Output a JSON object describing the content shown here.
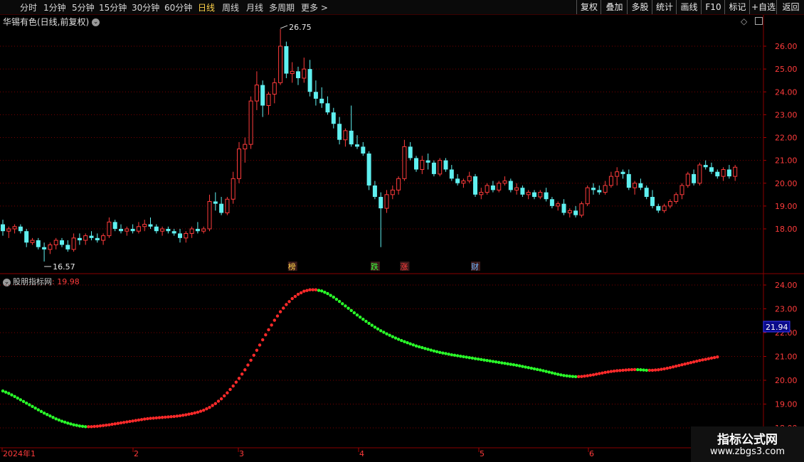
{
  "toolbar": {
    "periods": [
      "分时",
      "1分钟",
      "5分钟",
      "15分钟",
      "30分钟",
      "60分钟",
      "日线",
      "周线",
      "月线",
      "多周期",
      "更多 >"
    ],
    "active_period": "日线",
    "right_buttons": [
      "复权",
      "叠加",
      "多股",
      "统计",
      "画线",
      "F10",
      "标记",
      "+自选",
      "返回"
    ]
  },
  "main_panel": {
    "title": "华锡有色(日线,前复权)",
    "price_labels": [
      "26.00",
      "25.00",
      "24.00",
      "23.00",
      "22.00",
      "21.00",
      "20.00",
      "19.00",
      "18.00"
    ],
    "high_marker": "26.75",
    "low_marker": "16.57",
    "event_tags": [
      {
        "text": "榜",
        "color": "#ffd24a"
      },
      {
        "text": "跌",
        "color": "#3cff3c"
      },
      {
        "text": "涨",
        "color": "#ff3b3b"
      },
      {
        "text": "财",
        "color": "#6fb4ff"
      }
    ]
  },
  "sub_panel": {
    "name": "股朋指标网",
    "value": ": 19.98",
    "axis_labels": [
      "24.00",
      "23.00",
      "22.00",
      "21.00",
      "20.00",
      "19.00",
      "18.00"
    ],
    "current_value_badge": "21.94"
  },
  "x_axis": {
    "labels": [
      "2024年1",
      "2",
      "3",
      "4",
      "5",
      "6"
    ]
  },
  "watermark": {
    "title": "指标公式网",
    "url": "www.zbgs3.com"
  },
  "colors": {
    "up": "#ff3b3b",
    "down": "#5ff0f0",
    "indicator_up": "#ff2a2a",
    "indicator_down": "#2aff2a",
    "grid": "#7a0000",
    "active": "#ffd24a"
  },
  "chart_data": {
    "type": "candlestick",
    "title": "华锡有色(日线,前复权)",
    "ylim": [
      17.0,
      26.8
    ],
    "high": 26.75,
    "low": 16.57,
    "ohlc": [
      [
        18.2,
        18.4,
        17.7,
        17.9
      ],
      [
        17.9,
        18.1,
        17.6,
        18.0
      ],
      [
        18.0,
        18.2,
        17.8,
        18.1
      ],
      [
        18.1,
        18.2,
        17.8,
        17.9
      ],
      [
        17.9,
        18.0,
        17.2,
        17.4
      ],
      [
        17.4,
        17.6,
        17.3,
        17.5
      ],
      [
        17.5,
        17.6,
        17.1,
        17.2
      ],
      [
        17.2,
        17.4,
        16.57,
        17.1
      ],
      [
        17.1,
        17.4,
        16.9,
        17.3
      ],
      [
        17.3,
        17.6,
        17.1,
        17.5
      ],
      [
        17.5,
        17.6,
        17.2,
        17.3
      ],
      [
        17.3,
        17.5,
        17.0,
        17.1
      ],
      [
        17.1,
        17.8,
        17.0,
        17.6
      ],
      [
        17.6,
        17.8,
        17.3,
        17.5
      ],
      [
        17.5,
        17.8,
        17.3,
        17.7
      ],
      [
        17.7,
        17.9,
        17.5,
        17.6
      ],
      [
        17.6,
        17.8,
        17.4,
        17.5
      ],
      [
        17.5,
        17.8,
        17.3,
        17.7
      ],
      [
        17.7,
        18.5,
        17.6,
        18.3
      ],
      [
        18.3,
        18.4,
        17.9,
        18.0
      ],
      [
        18.0,
        18.2,
        17.8,
        17.9
      ],
      [
        17.9,
        18.1,
        17.7,
        18.0
      ],
      [
        18.0,
        18.2,
        17.8,
        17.9
      ],
      [
        17.9,
        18.3,
        17.8,
        18.1
      ],
      [
        18.1,
        18.4,
        17.9,
        18.2
      ],
      [
        18.2,
        18.5,
        18.0,
        18.1
      ],
      [
        18.1,
        18.2,
        17.8,
        17.9
      ],
      [
        17.9,
        18.1,
        17.7,
        18.0
      ],
      [
        18.0,
        18.1,
        17.8,
        17.9
      ],
      [
        17.9,
        18.0,
        17.7,
        17.8
      ],
      [
        17.8,
        18.0,
        17.4,
        17.6
      ],
      [
        17.6,
        17.9,
        17.4,
        17.8
      ],
      [
        17.8,
        18.1,
        17.6,
        18.0
      ],
      [
        18.0,
        18.3,
        17.8,
        17.9
      ],
      [
        17.9,
        18.1,
        17.8,
        18.0
      ],
      [
        18.0,
        19.5,
        17.9,
        19.2
      ],
      [
        19.2,
        19.6,
        18.8,
        19.1
      ],
      [
        19.1,
        19.4,
        18.6,
        18.7
      ],
      [
        18.7,
        19.4,
        18.6,
        19.3
      ],
      [
        19.3,
        20.5,
        19.1,
        20.2
      ],
      [
        20.2,
        21.8,
        20.0,
        21.5
      ],
      [
        21.5,
        22.0,
        20.9,
        21.7
      ],
      [
        21.7,
        23.8,
        21.5,
        23.6
      ],
      [
        23.6,
        24.9,
        23.2,
        24.3
      ],
      [
        24.3,
        24.5,
        22.9,
        23.4
      ],
      [
        23.4,
        24.0,
        23.0,
        23.9
      ],
      [
        23.9,
        24.6,
        23.5,
        24.4
      ],
      [
        24.4,
        26.75,
        24.3,
        26.0
      ],
      [
        26.0,
        26.2,
        24.6,
        24.8
      ],
      [
        24.8,
        25.3,
        24.4,
        24.9
      ],
      [
        24.9,
        25.1,
        24.3,
        24.6
      ],
      [
        24.6,
        25.5,
        24.4,
        25.0
      ],
      [
        25.0,
        25.4,
        23.8,
        24.0
      ],
      [
        24.0,
        24.5,
        23.4,
        23.7
      ],
      [
        23.7,
        24.2,
        23.3,
        23.5
      ],
      [
        23.5,
        23.8,
        23.0,
        23.1
      ],
      [
        23.1,
        23.3,
        22.4,
        22.6
      ],
      [
        22.6,
        22.9,
        21.7,
        21.9
      ],
      [
        21.9,
        22.4,
        21.6,
        22.3
      ],
      [
        22.3,
        23.4,
        21.6,
        21.7
      ],
      [
        21.7,
        22.1,
        21.5,
        21.6
      ],
      [
        21.6,
        21.8,
        21.2,
        21.3
      ],
      [
        21.3,
        21.4,
        19.7,
        19.9
      ],
      [
        19.9,
        20.1,
        19.3,
        19.4
      ],
      [
        19.4,
        19.6,
        17.2,
        18.9
      ],
      [
        18.9,
        19.7,
        18.7,
        19.5
      ],
      [
        19.5,
        19.9,
        19.3,
        19.7
      ],
      [
        19.7,
        20.3,
        19.5,
        20.2
      ],
      [
        20.2,
        21.9,
        20.1,
        21.6
      ],
      [
        21.6,
        21.8,
        21.0,
        21.1
      ],
      [
        21.1,
        21.2,
        20.5,
        20.6
      ],
      [
        20.6,
        21.2,
        20.4,
        21.0
      ],
      [
        21.0,
        21.3,
        20.6,
        20.9
      ],
      [
        20.9,
        21.0,
        20.3,
        20.4
      ],
      [
        20.4,
        21.1,
        20.3,
        21.0
      ],
      [
        21.0,
        21.1,
        20.5,
        20.6
      ],
      [
        20.6,
        20.8,
        20.1,
        20.2
      ],
      [
        20.2,
        20.4,
        19.9,
        20.0
      ],
      [
        20.0,
        20.2,
        19.8,
        20.1
      ],
      [
        20.1,
        20.5,
        20.0,
        20.3
      ],
      [
        20.3,
        20.4,
        19.4,
        19.5
      ],
      [
        19.5,
        19.8,
        19.3,
        19.6
      ],
      [
        19.6,
        20.0,
        19.5,
        19.9
      ],
      [
        19.9,
        20.1,
        19.6,
        19.7
      ],
      [
        19.7,
        20.1,
        19.6,
        20.0
      ],
      [
        20.0,
        20.3,
        19.9,
        20.1
      ],
      [
        20.1,
        20.2,
        19.6,
        19.7
      ],
      [
        19.7,
        20.0,
        19.5,
        19.8
      ],
      [
        19.8,
        19.9,
        19.4,
        19.5
      ],
      [
        19.5,
        19.7,
        19.3,
        19.6
      ],
      [
        19.6,
        19.7,
        19.3,
        19.4
      ],
      [
        19.4,
        19.7,
        19.3,
        19.6
      ],
      [
        19.6,
        19.8,
        19.2,
        19.3
      ],
      [
        19.3,
        19.4,
        18.9,
        19.0
      ],
      [
        19.0,
        19.2,
        18.8,
        19.1
      ],
      [
        19.1,
        19.3,
        18.6,
        18.7
      ],
      [
        18.7,
        18.9,
        18.5,
        18.8
      ],
      [
        18.8,
        19.0,
        18.5,
        18.6
      ],
      [
        18.6,
        19.2,
        18.5,
        19.1
      ],
      [
        19.1,
        19.9,
        19.0,
        19.8
      ],
      [
        19.8,
        20.0,
        19.5,
        19.7
      ],
      [
        19.7,
        19.9,
        19.5,
        19.6
      ],
      [
        19.6,
        20.1,
        19.5,
        19.9
      ],
      [
        19.9,
        20.5,
        19.8,
        20.3
      ],
      [
        20.3,
        20.7,
        19.9,
        20.5
      ],
      [
        20.5,
        20.6,
        20.2,
        20.4
      ],
      [
        20.4,
        20.6,
        19.7,
        19.8
      ],
      [
        19.8,
        20.1,
        19.5,
        20.0
      ],
      [
        20.0,
        20.2,
        19.7,
        19.8
      ],
      [
        19.8,
        19.9,
        19.3,
        19.4
      ],
      [
        19.4,
        19.7,
        18.9,
        19.0
      ],
      [
        19.0,
        19.1,
        18.7,
        18.8
      ],
      [
        18.8,
        19.1,
        18.7,
        19.0
      ],
      [
        19.0,
        19.3,
        18.9,
        19.2
      ],
      [
        19.2,
        19.6,
        19.1,
        19.5
      ],
      [
        19.5,
        20.0,
        19.3,
        19.9
      ],
      [
        19.9,
        20.5,
        19.8,
        20.4
      ],
      [
        20.4,
        20.6,
        19.9,
        20.0
      ],
      [
        20.0,
        20.9,
        19.9,
        20.8
      ],
      [
        20.8,
        21.0,
        20.6,
        20.7
      ],
      [
        20.7,
        20.9,
        20.4,
        20.5
      ],
      [
        20.5,
        20.6,
        20.2,
        20.3
      ],
      [
        20.3,
        20.7,
        20.1,
        20.6
      ],
      [
        20.6,
        20.8,
        20.2,
        20.3
      ],
      [
        20.3,
        20.8,
        20.1,
        20.7
      ]
    ]
  },
  "indicator_data": {
    "type": "line",
    "ylim": [
      17.8,
      24.4
    ],
    "values": [
      19.55,
      19.45,
      19.32,
      19.18,
      19.04,
      18.9,
      18.76,
      18.62,
      18.5,
      18.38,
      18.28,
      18.2,
      18.13,
      18.08,
      18.05,
      18.05,
      18.07,
      18.1,
      18.13,
      18.17,
      18.21,
      18.25,
      18.29,
      18.33,
      18.37,
      18.4,
      18.42,
      18.44,
      18.46,
      18.48,
      18.51,
      18.55,
      18.6,
      18.66,
      18.74,
      18.86,
      19.02,
      19.22,
      19.47,
      19.76,
      20.08,
      20.44,
      20.84,
      21.26,
      21.7,
      22.12,
      22.52,
      22.88,
      23.18,
      23.43,
      23.61,
      23.74,
      23.8,
      23.8,
      23.75,
      23.64,
      23.49,
      23.31,
      23.12,
      22.93,
      22.74,
      22.56,
      22.39,
      22.23,
      22.08,
      21.95,
      21.83,
      21.72,
      21.62,
      21.53,
      21.44,
      21.37,
      21.3,
      21.23,
      21.17,
      21.12,
      21.07,
      21.03,
      20.99,
      20.95,
      20.91,
      20.87,
      20.83,
      20.79,
      20.75,
      20.71,
      20.67,
      20.63,
      20.58,
      20.53,
      20.48,
      20.43,
      20.37,
      20.31,
      20.25,
      20.2,
      20.17,
      20.15,
      20.16,
      20.19,
      20.23,
      20.28,
      20.33,
      20.37,
      20.4,
      20.42,
      20.44,
      20.45,
      20.44,
      20.42,
      20.42,
      20.44,
      20.48,
      20.53,
      20.59,
      20.65,
      20.71,
      20.77,
      20.83,
      20.88,
      20.93,
      20.98
    ]
  }
}
